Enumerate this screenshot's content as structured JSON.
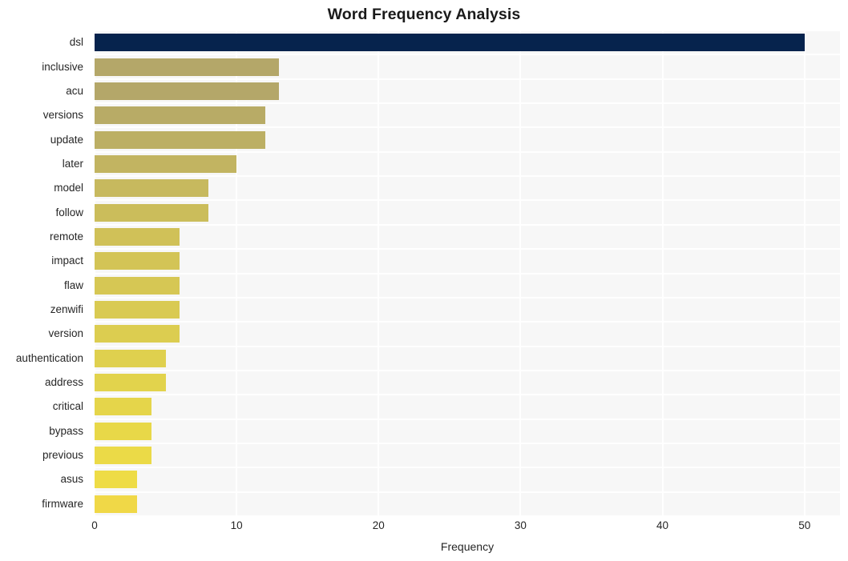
{
  "chart_data": {
    "type": "bar",
    "orientation": "horizontal",
    "title": "Word Frequency Analysis",
    "xlabel": "Frequency",
    "ylabel": "",
    "xlim": [
      0,
      52.5
    ],
    "ylim": [
      0,
      20
    ],
    "grid": true,
    "legend": null,
    "xticks": [
      "0",
      "10",
      "20",
      "30",
      "40",
      "50"
    ],
    "xtick_values": [
      0,
      10,
      20,
      30,
      40,
      50
    ],
    "categories": [
      "dsl",
      "inclusive",
      "acu",
      "versions",
      "update",
      "later",
      "model",
      "follow",
      "remote",
      "impact",
      "flaw",
      "zenwifi",
      "version",
      "authentication",
      "address",
      "critical",
      "bypass",
      "previous",
      "asus",
      "firmware"
    ],
    "values": [
      50,
      13,
      13,
      12,
      12,
      10,
      8,
      8,
      6,
      6,
      6,
      6,
      6,
      5,
      5,
      4,
      4,
      4,
      3,
      3
    ],
    "bar_colors": [
      "#06234d",
      "#b4a769",
      "#b4a769",
      "#b8ab66",
      "#bcaf64",
      "#c2b461",
      "#c7b95e",
      "#cbbd5b",
      "#d0c158",
      "#d3c456",
      "#d6c754",
      "#d9ca52",
      "#dccd50",
      "#dfd04e",
      "#e2d34c",
      "#e5d54a",
      "#e8d848",
      "#ebda47",
      "#eedc46",
      "#f0d847"
    ],
    "plot_background": "#f7f7f7",
    "figure_background": "#ffffff",
    "gridline_color": "#ffffff",
    "text_color": "#262626",
    "title_color": "#1a1a1a"
  }
}
